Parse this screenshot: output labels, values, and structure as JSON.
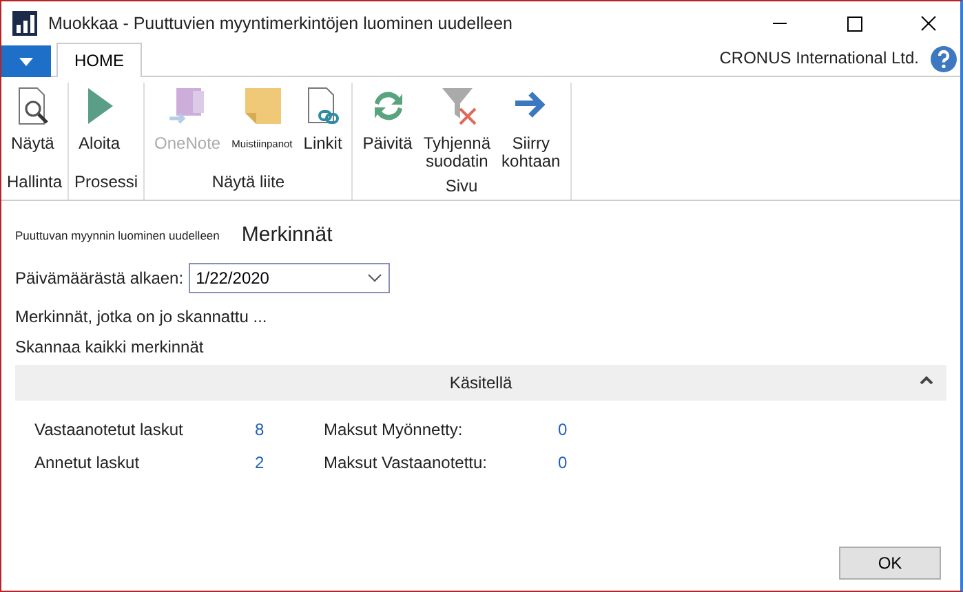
{
  "window": {
    "title": "Muokkaa - Puuttuvien myyntimerkintöjen luominen uudelleen"
  },
  "tabs": [
    {
      "label": "HOME",
      "selected": true
    }
  ],
  "company": "CRONUS International Ltd.",
  "ribbon": [
    {
      "group": "Hallinta",
      "buttons": [
        {
          "kind": "view",
          "lines": [
            "Näytä"
          ],
          "disabled": false
        }
      ]
    },
    {
      "group": "Prosessi",
      "buttons": [
        {
          "kind": "play",
          "lines": [
            "Aloita"
          ],
          "disabled": false
        }
      ]
    },
    {
      "group": "Näytä liite",
      "buttons": [
        {
          "kind": "onenote",
          "lines": [
            "OneNote"
          ],
          "disabled": true
        },
        {
          "kind": "note",
          "lines": [
            "Muistiinpanot"
          ],
          "disabled": false,
          "small": true
        },
        {
          "kind": "link",
          "lines": [
            "Linkit"
          ],
          "disabled": false
        }
      ]
    },
    {
      "group": "Sivu",
      "buttons": [
        {
          "kind": "refresh",
          "lines": [
            "Päivitä"
          ],
          "disabled": false
        },
        {
          "kind": "filter",
          "lines": [
            "Tyhjennä",
            "suodatin"
          ],
          "disabled": false
        },
        {
          "kind": "goto",
          "lines": [
            "Siirry",
            "kohtaan"
          ],
          "disabled": false
        }
      ]
    }
  ],
  "page": {
    "caption": "Puuttuvan myynnin luominen uudelleen",
    "title": "Merkinnät"
  },
  "date_field": {
    "label": "Päivämäärästä alkaen:",
    "value": "1/22/2020"
  },
  "links": [
    "Merkinnät, jotka on jo skannattu ...",
    "Skannaa kaikki merkinnät"
  ],
  "section": {
    "title": "Käsitellä",
    "expanded": true,
    "fields": [
      {
        "label": "Vastaanotetut laskut",
        "value": "8"
      },
      {
        "label": "Maksut Myönnetty:",
        "value": "0"
      },
      {
        "label": "Annetut laskut",
        "value": "2"
      },
      {
        "label": "Maksut Vastaanotettu:",
        "value": "0"
      }
    ]
  },
  "buttons": [
    "OK"
  ]
}
